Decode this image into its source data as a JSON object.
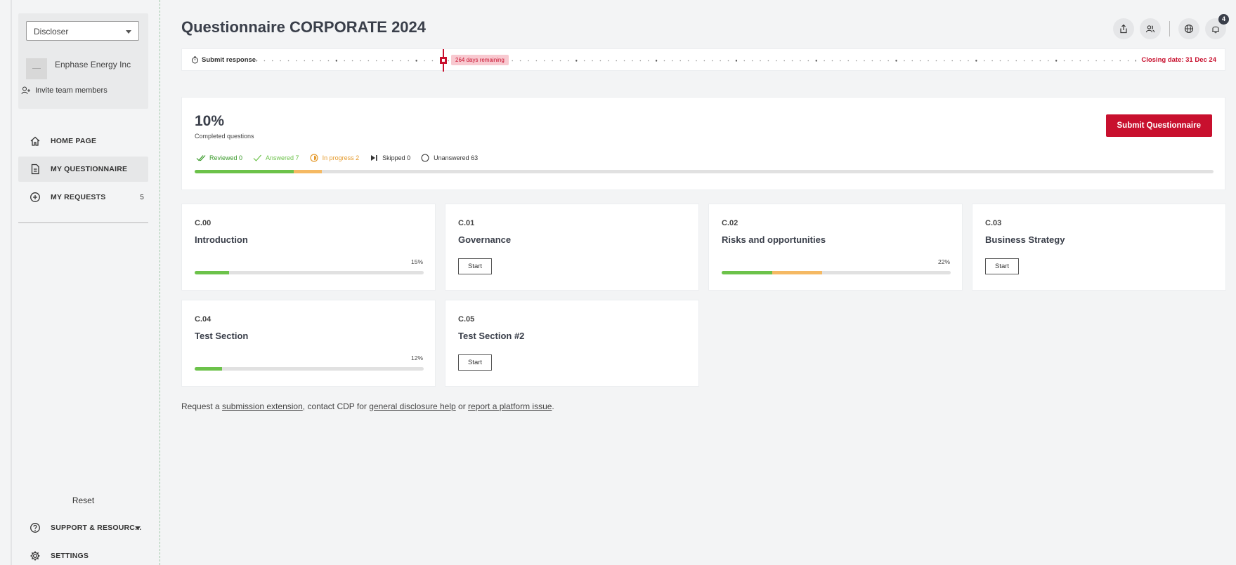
{
  "sidebar": {
    "role_select": "Discloser",
    "company_name": "Enphase Energy Inc",
    "invite_label": "Invite team members",
    "nav": [
      {
        "label": "HOME PAGE",
        "icon": "home-icon"
      },
      {
        "label": "MY QUESTIONNAIRE",
        "icon": "document-icon",
        "active": true
      },
      {
        "label": "MY REQUESTS",
        "icon": "plus-circle-icon",
        "count": "5"
      }
    ],
    "reset_label": "Reset",
    "support_label": "SUPPORT & RESOURC...",
    "settings_label": "SETTINGS"
  },
  "header": {
    "title": "Questionnaire CORPORATE 2024",
    "notification_count": "4",
    "icons": [
      "share-icon",
      "team-icon",
      "globe-icon",
      "bell-icon"
    ]
  },
  "timeline": {
    "label": "Submit response",
    "days_remaining": "264 days remaining",
    "closing_date": "Closing date: 31 Dec 24",
    "marker_position": 0.25
  },
  "progress": {
    "percent": "10%",
    "label": "Completed questions",
    "button": "Submit Questionnaire",
    "legend": {
      "reviewed": "Reviewed 0",
      "answered": "Answered 7",
      "in_progress": "In progress 2",
      "skipped": "Skipped 0",
      "unanswered": "Unanswered 63"
    },
    "answered_fraction": 0.097,
    "in_progress_fraction": 0.028,
    "colors": {
      "answered": "#6cc24a",
      "in_progress": "#f5b963",
      "reviewed": "#3a9a2a",
      "accent": "#c8102e"
    }
  },
  "sections": [
    {
      "code": "C.00",
      "name": "Introduction",
      "percent": "15%",
      "answered": 0.15,
      "in_progress": 0
    },
    {
      "code": "C.01",
      "name": "Governance",
      "start": "Start"
    },
    {
      "code": "C.02",
      "name": "Risks and opportunities",
      "percent": "22%",
      "answered": 0.22,
      "in_progress": 0.22
    },
    {
      "code": "C.03",
      "name": "Business Strategy",
      "start": "Start"
    },
    {
      "code": "C.04",
      "name": "Test Section",
      "percent": "12%",
      "answered": 0.12,
      "in_progress": 0
    },
    {
      "code": "C.05",
      "name": "Test Section #2",
      "start": "Start"
    }
  ],
  "footer": {
    "t1": "Request a ",
    "link1": "submission extension",
    "t2": ", contact CDP for ",
    "link2": "general disclosure help",
    "t3": " or ",
    "link3": "report a platform issue",
    "t4": "."
  }
}
